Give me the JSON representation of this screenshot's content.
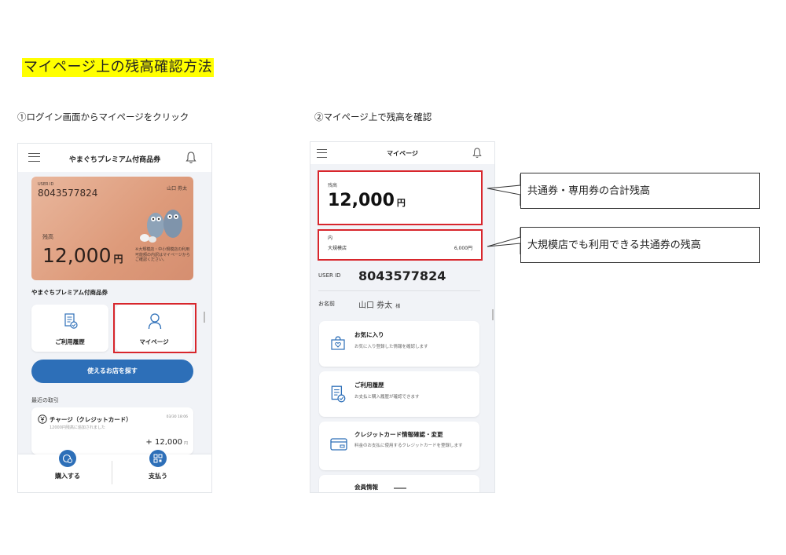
{
  "doc_title": "マイページ上の残高確認方法",
  "step1": "①ログイン画面からマイページをクリック",
  "step2": "②マイページ上で残高を確認",
  "phone1": {
    "app_title": "やまぐちプレミアム付商品券",
    "card": {
      "user_id_label": "USER ID",
      "user_id": "8043577824",
      "user_name": "山口 券太",
      "balance_label": "残高",
      "balance": "12,000",
      "currency": "円",
      "note": "※大規模店・中小規模店の利用可能額の内訳はマイページからご確認ください。"
    },
    "section_title": "やまぐちプレミアム付商品券",
    "history_button": "ご利用履歴",
    "mypage_button": "マイページ",
    "find_store_button": "使えるお店を探す",
    "recent_label": "最近の取引",
    "transaction": {
      "title": "チャージ（クレジットカード）",
      "date": "03/30 18:06",
      "desc": "12000円残高に追加されました",
      "amount": "+ 12,000",
      "currency": "円"
    },
    "purchase_label": "購入する",
    "pay_label": "支払う"
  },
  "phone2": {
    "app_title": "マイページ",
    "balance_label": "残高",
    "balance": "12,000",
    "currency": "円",
    "breakdown_label": "内",
    "large_store_label": "大規模店",
    "large_store_amount": "6,000円",
    "user_id_label": "USER ID",
    "user_id": "8043577824",
    "name_label": "お名前",
    "name": "山口 券太",
    "honorific": "様",
    "menu": [
      {
        "title": "お気に入り",
        "desc": "お気に入り登録した情報を確認します"
      },
      {
        "title": "ご利用履歴",
        "desc": "お支払と購入履歴が確認できます"
      },
      {
        "title": "クレジットカード情報確認・変更",
        "desc": "料金のお支払に使用するクレジットカードを登録します"
      },
      {
        "title": "会員情報",
        "desc": ""
      }
    ]
  },
  "callout1": "共通券・専用券の合計残高",
  "callout2": "大規模店でも利用できる共通券の残高",
  "colors": {
    "highlight": "#ffff00",
    "red": "#d8262c",
    "blue": "#2d6fb8",
    "card": "#dd9a7a"
  }
}
